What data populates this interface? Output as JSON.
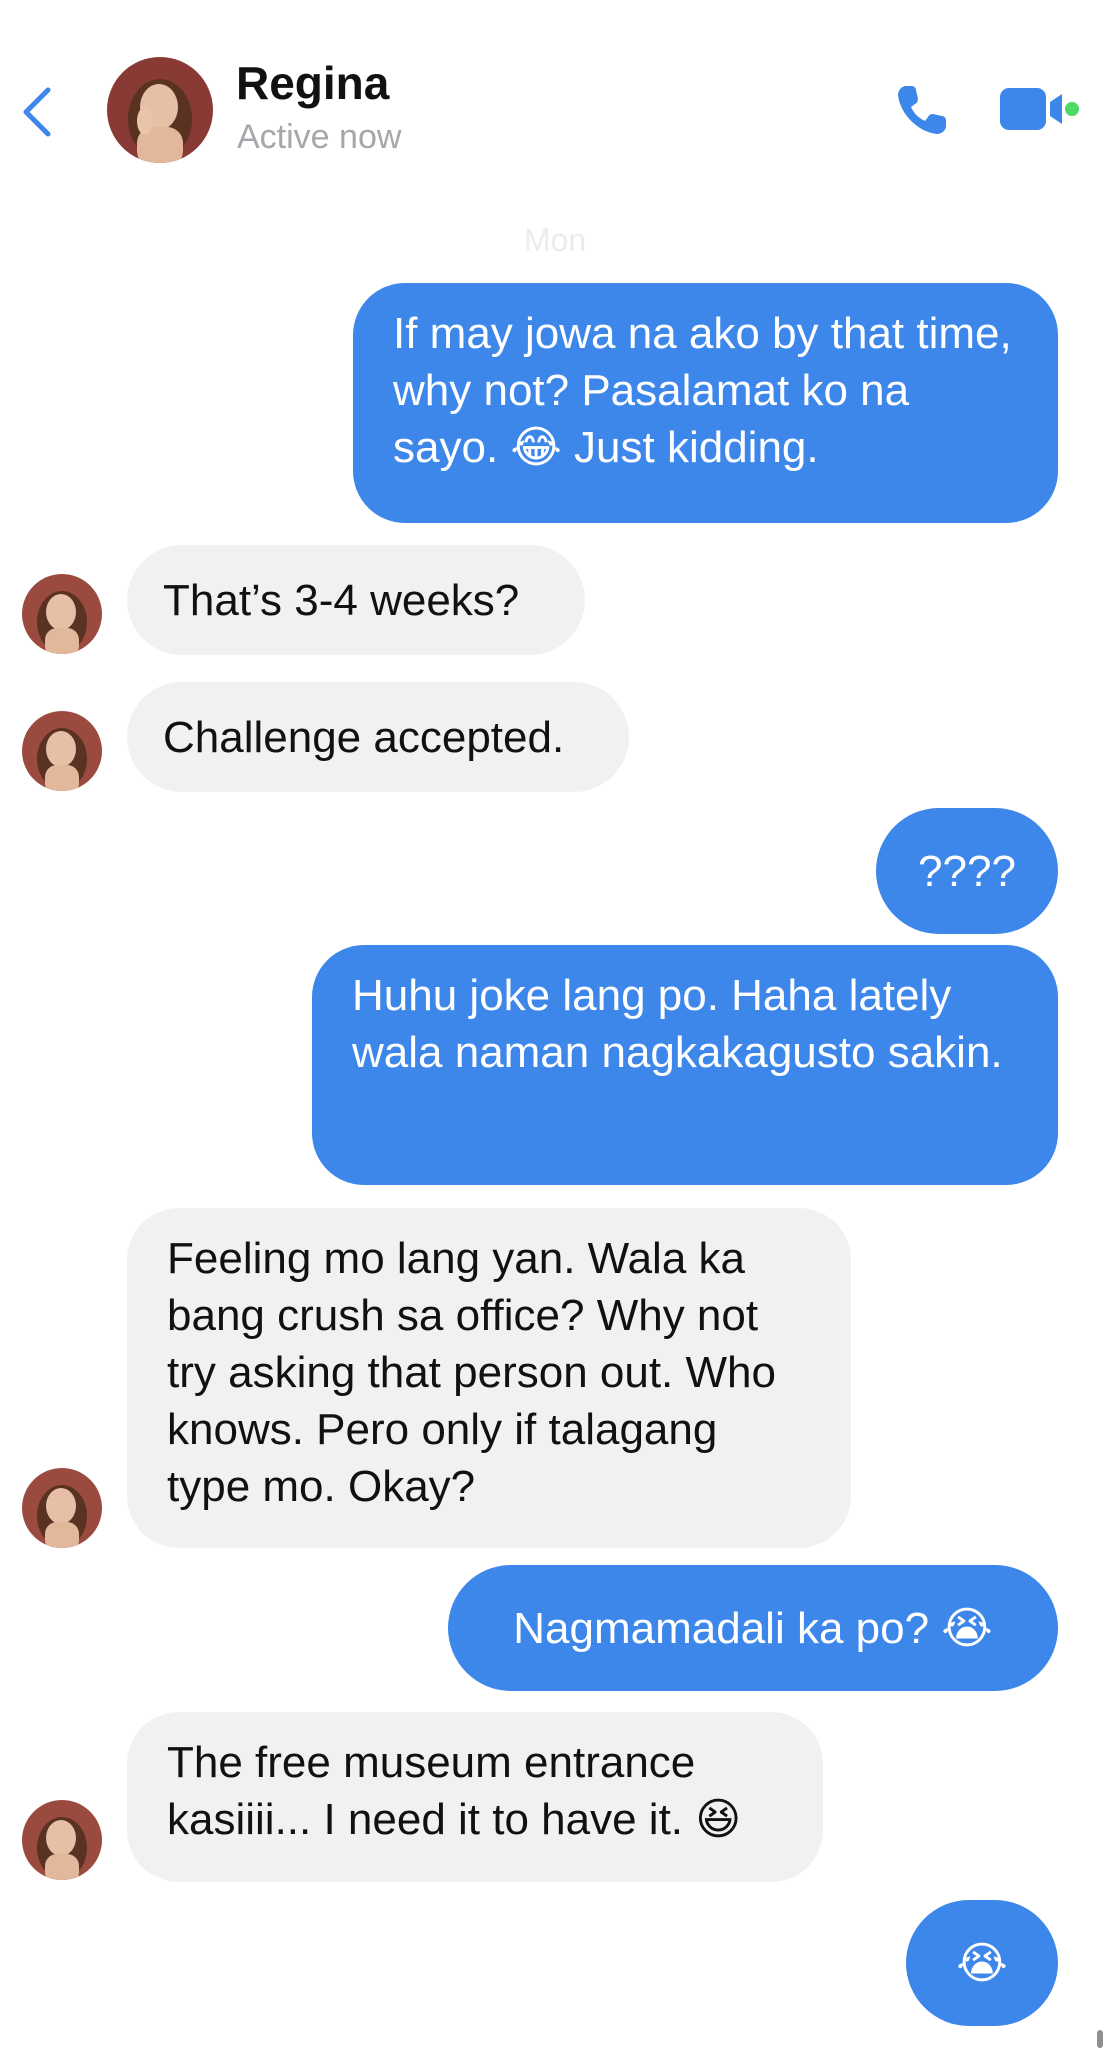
{
  "header": {
    "contact_name": "Regina",
    "status": "Active now",
    "back_icon": "chevron-left-icon",
    "call_icon": "phone-icon",
    "video_icon": "video-camera-icon",
    "accent_color": "#3d86ea",
    "online_dot_color": "#4cd964"
  },
  "date_separator": "Mon",
  "colors": {
    "outgoing_bubble": "#3d86ea",
    "incoming_bubble": "#f1f1f2"
  },
  "messages": [
    {
      "from": "me",
      "text": "If may jowa na ako by that time, why not? Pasalamat ko na sayo. 😂 Just kidding."
    },
    {
      "from": "Regina",
      "text": "That’s 3-4 weeks?"
    },
    {
      "from": "Regina",
      "text": "Challenge accepted."
    },
    {
      "from": "me",
      "text": "????"
    },
    {
      "from": "me",
      "text": "Huhu joke lang po. Haha lately wala naman nagkakagusto sakin."
    },
    {
      "from": "Regina",
      "text": "Feeling mo lang yan. Wala ka bang crush sa office? Why not try asking that person out. Who knows. Pero only if talagang type mo. Okay?"
    },
    {
      "from": "me",
      "text": "Nagmamadali ka po? 😭"
    },
    {
      "from": "Regina",
      "text": "The free museum entrance kasiiii... I need it to have it. 😆"
    },
    {
      "from": "me",
      "text": "😭"
    }
  ]
}
